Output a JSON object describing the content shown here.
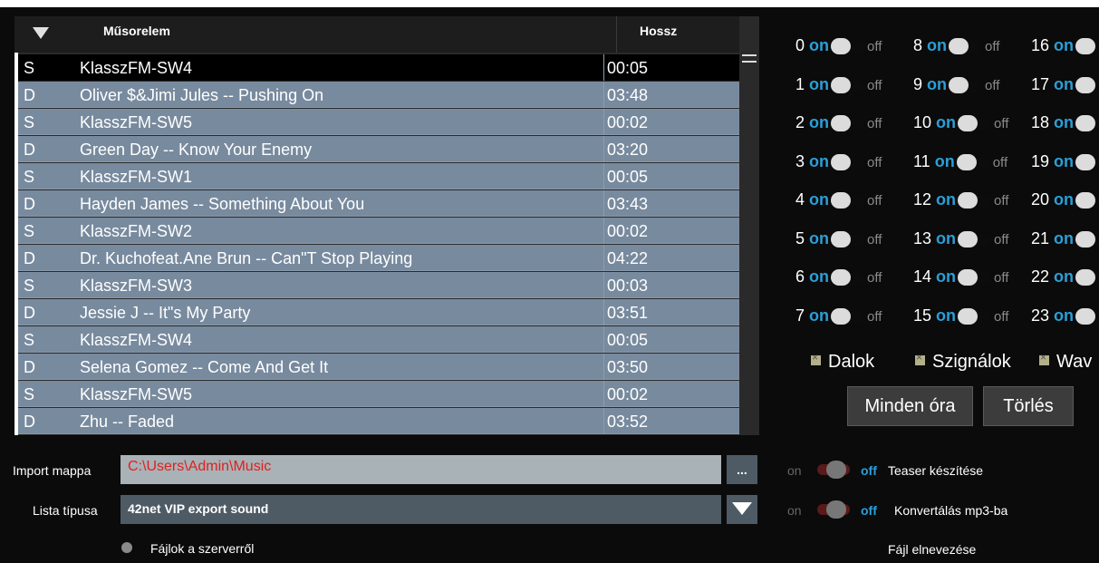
{
  "playlist": {
    "col_title": "Műsorelem",
    "col_length": "Hossz",
    "rows": [
      {
        "type": "S",
        "title": "KlasszFM-SW4",
        "length": "00:05"
      },
      {
        "type": "D",
        "title": "Oliver $&Jimi Jules -- Pushing On",
        "length": "03:48"
      },
      {
        "type": "S",
        "title": "KlasszFM-SW5",
        "length": "00:02"
      },
      {
        "type": "D",
        "title": "Green Day -- Know Your Enemy",
        "length": "03:20"
      },
      {
        "type": "S",
        "title": "KlasszFM-SW1",
        "length": "00:05"
      },
      {
        "type": "D",
        "title": "Hayden James -- Something About You",
        "length": "03:43"
      },
      {
        "type": "S",
        "title": "KlasszFM-SW2",
        "length": "00:02"
      },
      {
        "type": "D",
        "title": "Dr. Kuchofeat.Ane Brun -- Can\"T Stop Playing",
        "length": "04:22"
      },
      {
        "type": "S",
        "title": "KlasszFM-SW3",
        "length": "00:03"
      },
      {
        "type": "D",
        "title": "Jessie J -- It\"s My Party",
        "length": "03:51"
      },
      {
        "type": "S",
        "title": "KlasszFM-SW4",
        "length": "00:05"
      },
      {
        "type": "D",
        "title": "Selena Gomez -- Come And Get It",
        "length": "03:50"
      },
      {
        "type": "S",
        "title": "KlasszFM-SW5",
        "length": "00:02"
      },
      {
        "type": "D",
        "title": "Zhu -- Faded",
        "length": "03:52"
      }
    ]
  },
  "import": {
    "folder_label": "Import mappa",
    "folder_value": "C:\\Users\\Admin\\Music",
    "browse_label": "...",
    "list_type_label": "Lista típusa",
    "list_type_value": "42net VIP export sound",
    "server_files_label": "Fájlok a szerverről"
  },
  "hours": {
    "on": "on",
    "off": "off",
    "col1": [
      "0",
      "1",
      "2",
      "3",
      "4",
      "5",
      "6",
      "7"
    ],
    "col2": [
      "8",
      "9",
      "10",
      "11",
      "12",
      "13",
      "14",
      "15"
    ],
    "col3": [
      "16",
      "17",
      "18",
      "19",
      "20",
      "21",
      "22",
      "23"
    ]
  },
  "filters": {
    "songs": "Dalok",
    "jingles": "Szignálok",
    "wav": "Wav"
  },
  "buttons": {
    "all_hours": "Minden óra",
    "delete": "Törlés"
  },
  "options": {
    "on": "on",
    "off": "off",
    "teaser": "Teaser készítése",
    "convert": "Konvertálás mp3-ba",
    "file_naming": "Fájl elnevezése"
  },
  "colors": {
    "row_bg": "#788a9e",
    "accent_on": "#2a9fd8",
    "path_red": "#e02020"
  }
}
